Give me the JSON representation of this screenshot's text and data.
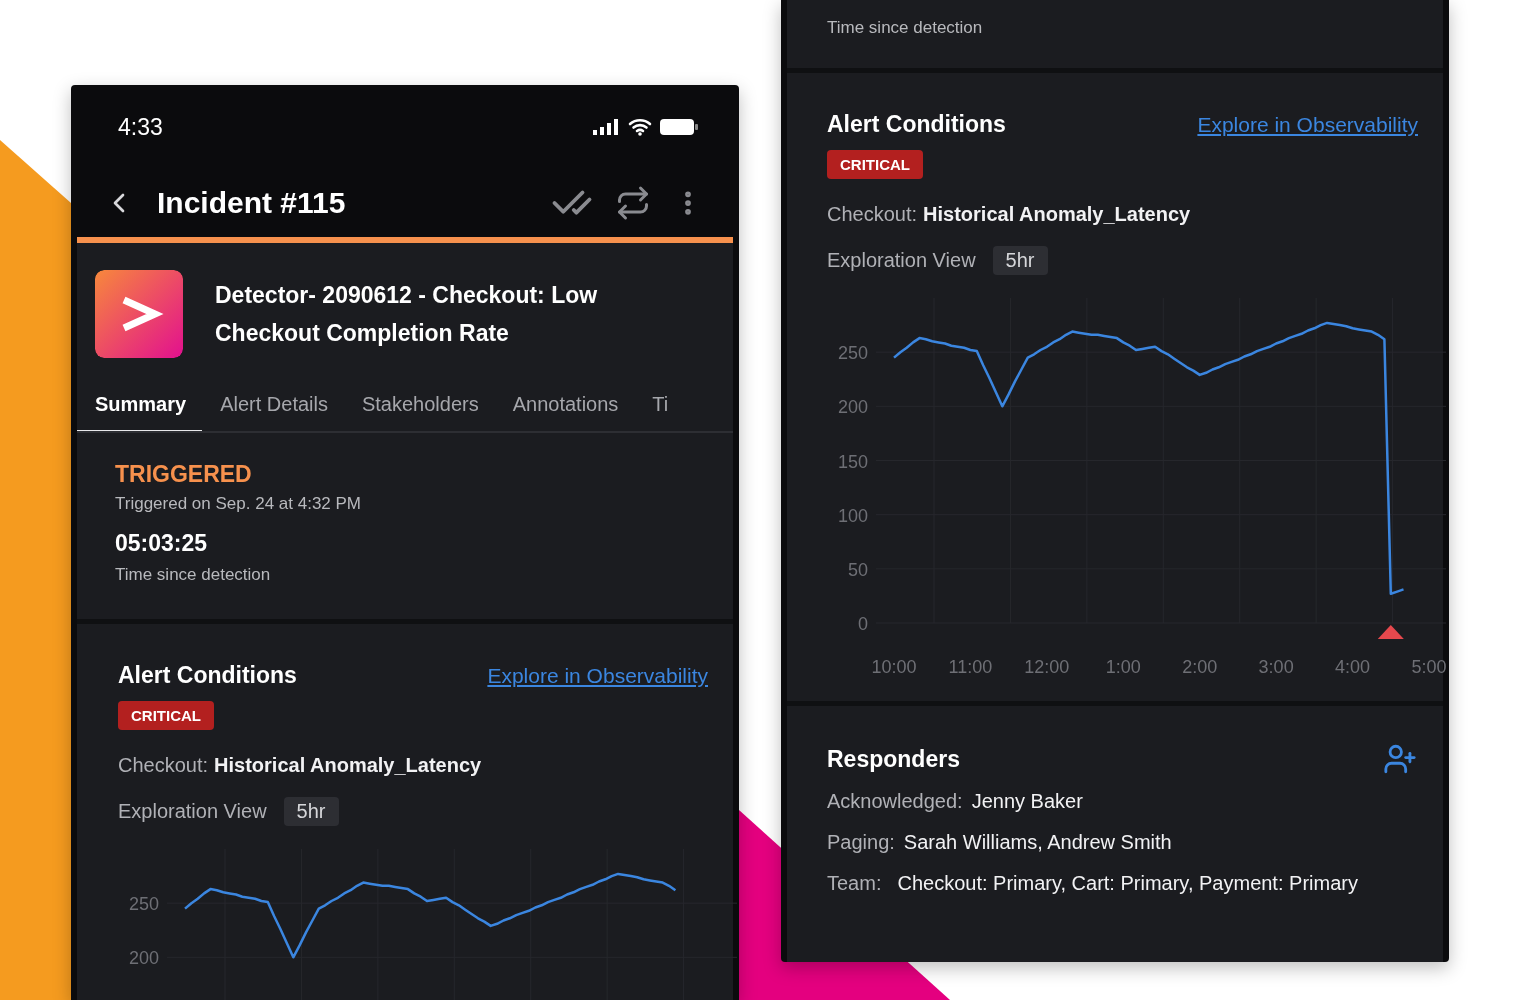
{
  "left_screen": {
    "status_bar": {
      "time": "4:33"
    },
    "header": {
      "title": "Incident #115"
    },
    "incident": {
      "title": "Detector- 2090612 - Checkout: Low Checkout Completion Rate"
    },
    "tabs": [
      {
        "label": "Summary",
        "selected": true
      },
      {
        "label": "Alert Details",
        "selected": false
      },
      {
        "label": "Stakeholders",
        "selected": false
      },
      {
        "label": "Annotations",
        "selected": false
      },
      {
        "label": "Ti",
        "selected": false
      }
    ],
    "status": {
      "state": "TRIGGERED",
      "triggered_on": "Triggered on Sep. 24 at 4:32 PM",
      "elapsed": "05:03:25",
      "elapsed_label": "Time since detection"
    },
    "alert_conditions": {
      "title": "Alert Conditions",
      "link": "Explore in Observability",
      "severity": "CRITICAL",
      "condition_label": "Checkout:",
      "condition": "Historical Anomaly_Latency",
      "view_label": "Exploration View",
      "view_range": "5hr",
      "chart_data": {
        "type": "line",
        "grid": true,
        "categories": [
          null,
          null,
          null,
          null,
          null,
          null,
          null,
          null,
          null,
          null,
          null,
          null,
          null,
          null,
          null,
          null,
          null,
          null,
          null,
          null,
          null,
          null,
          null,
          null,
          null,
          null,
          null,
          null,
          null,
          null,
          null,
          null,
          null,
          null,
          null,
          null,
          null,
          null,
          null,
          null,
          null,
          null,
          null,
          null,
          null,
          null,
          null,
          null,
          null,
          null,
          null,
          null,
          null,
          null,
          null,
          null,
          null,
          null,
          null,
          null,
          null,
          null,
          null,
          null,
          null,
          null,
          null,
          null,
          null,
          null,
          null,
          null,
          null,
          null,
          null,
          null,
          null,
          null,
          null,
          null,
          null,
          null,
          null,
          null,
          null
        ],
        "ylim": [
          0,
          300
        ],
        "yticks": [
          200,
          250
        ],
        "series": [
          {
            "color": "#3b86e0",
            "values": [
              245,
              250,
              254,
              259,
              263,
              262,
              260,
              259,
              258,
              256,
              255,
              254,
              252,
              251,
              238,
              226,
              213,
              200,
              211,
              223,
              234,
              245,
              248,
              252,
              255,
              259,
              262,
              266,
              269,
              268,
              267,
              266,
              266,
              265,
              264,
              263,
              259,
              256,
              252,
              253,
              254,
              255,
              251,
              248,
              244,
              240,
              236,
              233,
              229,
              231,
              234,
              236,
              239,
              241,
              243,
              246,
              248,
              251,
              253,
              255,
              258,
              260,
              263,
              265,
              267,
              270,
              272,
              275,
              277,
              276,
              275,
              274,
              272,
              271,
              270,
              269,
              266,
              262,
              null,
              null,
              null,
              null,
              null,
              null,
              null
            ]
          }
        ]
      }
    }
  },
  "right_screen": {
    "status": {
      "elapsed_label": "Time since detection"
    },
    "alert_conditions": {
      "title": "Alert Conditions",
      "link": "Explore in Observability",
      "severity": "CRITICAL",
      "condition_label": "Checkout:",
      "condition": "Historical Anomaly_Latency",
      "view_label": "Exploration View",
      "view_range": "5hr",
      "chart_data": {
        "type": "line",
        "grid": true,
        "categories": [
          "10:00",
          null,
          null,
          null,
          null,
          null,
          null,
          null,
          null,
          null,
          null,
          null,
          "11:00",
          null,
          null,
          null,
          null,
          null,
          null,
          null,
          null,
          null,
          null,
          null,
          "12:00",
          null,
          null,
          null,
          null,
          null,
          null,
          null,
          null,
          null,
          null,
          null,
          "1:00",
          null,
          null,
          null,
          null,
          null,
          null,
          null,
          null,
          null,
          null,
          null,
          "2:00",
          null,
          null,
          null,
          null,
          null,
          null,
          null,
          null,
          null,
          null,
          null,
          "3:00",
          null,
          null,
          null,
          null,
          null,
          null,
          null,
          null,
          null,
          null,
          null,
          "4:00",
          null,
          null,
          null,
          null,
          null,
          null,
          null,
          null,
          null,
          null,
          null,
          "5:00"
        ],
        "ylim": [
          0,
          300
        ],
        "yticks": [
          0,
          50,
          100,
          150,
          200,
          250
        ],
        "series": [
          {
            "color": "#3b86e0",
            "values": [
              245,
              250,
              254,
              259,
              263,
              262,
              260,
              259,
              258,
              256,
              255,
              254,
              252,
              251,
              238,
              226,
              213,
              200,
              211,
              223,
              234,
              245,
              248,
              252,
              255,
              259,
              262,
              266,
              269,
              268,
              267,
              266,
              266,
              265,
              264,
              263,
              259,
              256,
              252,
              253,
              254,
              255,
              251,
              248,
              244,
              240,
              236,
              233,
              229,
              231,
              234,
              236,
              239,
              241,
              243,
              246,
              248,
              251,
              253,
              255,
              258,
              260,
              263,
              265,
              267,
              270,
              272,
              275,
              277,
              276,
              275,
              274,
              272,
              271,
              270,
              269,
              266,
              262,
              27,
              29,
              31,
              null,
              null,
              null,
              null
            ]
          }
        ]
      }
    },
    "responders": {
      "title": "Responders",
      "rows": [
        {
          "label": "Acknowledged:",
          "value": "Jenny Baker"
        },
        {
          "label": "Paging:",
          "value": "Sarah Williams, Andrew Smith"
        },
        {
          "label": "Team:",
          "value": "Checkout: Primary, Cart: Primary, Payment: Primary"
        }
      ]
    }
  }
}
